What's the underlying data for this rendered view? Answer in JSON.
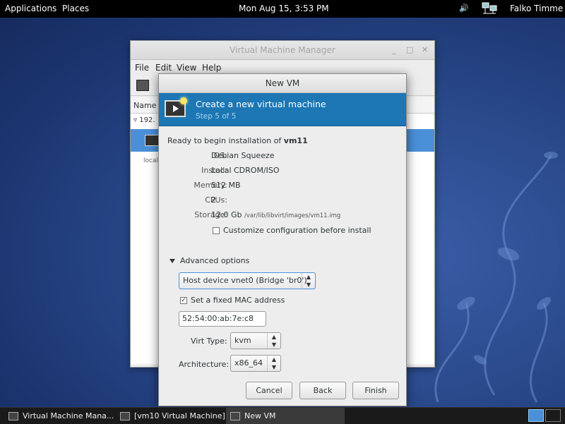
{
  "topbar": {
    "applications": "Applications",
    "places": "Places",
    "clock": "Mon Aug 15,  3:53 PM",
    "user": "Falko Timme",
    "volume_icon": "volume-icon",
    "network_icon": "network-icon"
  },
  "vmm_window": {
    "title": "Virtual Machine Manager",
    "menu": [
      "File",
      "Edit",
      "View",
      "Help"
    ],
    "column_name": "Name",
    "host_row": "192.",
    "localhost": "localh"
  },
  "dialog": {
    "title": "New VM",
    "banner_title": "Create a new virtual machine",
    "banner_step": "Step 5 of 5",
    "ready_prefix": "Ready to begin installation of ",
    "vm_name": "vm11",
    "os_label": "OS:",
    "os_value": "Debian Squeeze",
    "install_label": "Install:",
    "install_value": "Local CDROM/ISO",
    "memory_label": "Memory:",
    "memory_value": "512 MB",
    "cpus_label": "CPUs:",
    "cpus_value": "2",
    "storage_label": "Storage:",
    "storage_value": "12.0 Gb",
    "storage_path": "/var/lib/libvirt/images/vm11.img",
    "customize_label": "Customize configuration before install",
    "customize_checked": false,
    "advanced_label": "Advanced options",
    "network_value": "Host device vnet0 (Bridge 'br0')",
    "fixed_mac_label": "Set a fixed MAC address",
    "fixed_mac_checked": true,
    "mac_value": "52:54:00:ab:7e:c8",
    "virt_type_label": "Virt Type:",
    "virt_type_value": "kvm",
    "arch_label": "Architecture:",
    "arch_value": "x86_64",
    "cancel": "Cancel",
    "back": "Back",
    "finish": "Finish"
  },
  "taskbar": {
    "tasks": [
      "Virtual Machine Mana...",
      "[vm10 Virtual Machine]",
      "New VM"
    ]
  }
}
